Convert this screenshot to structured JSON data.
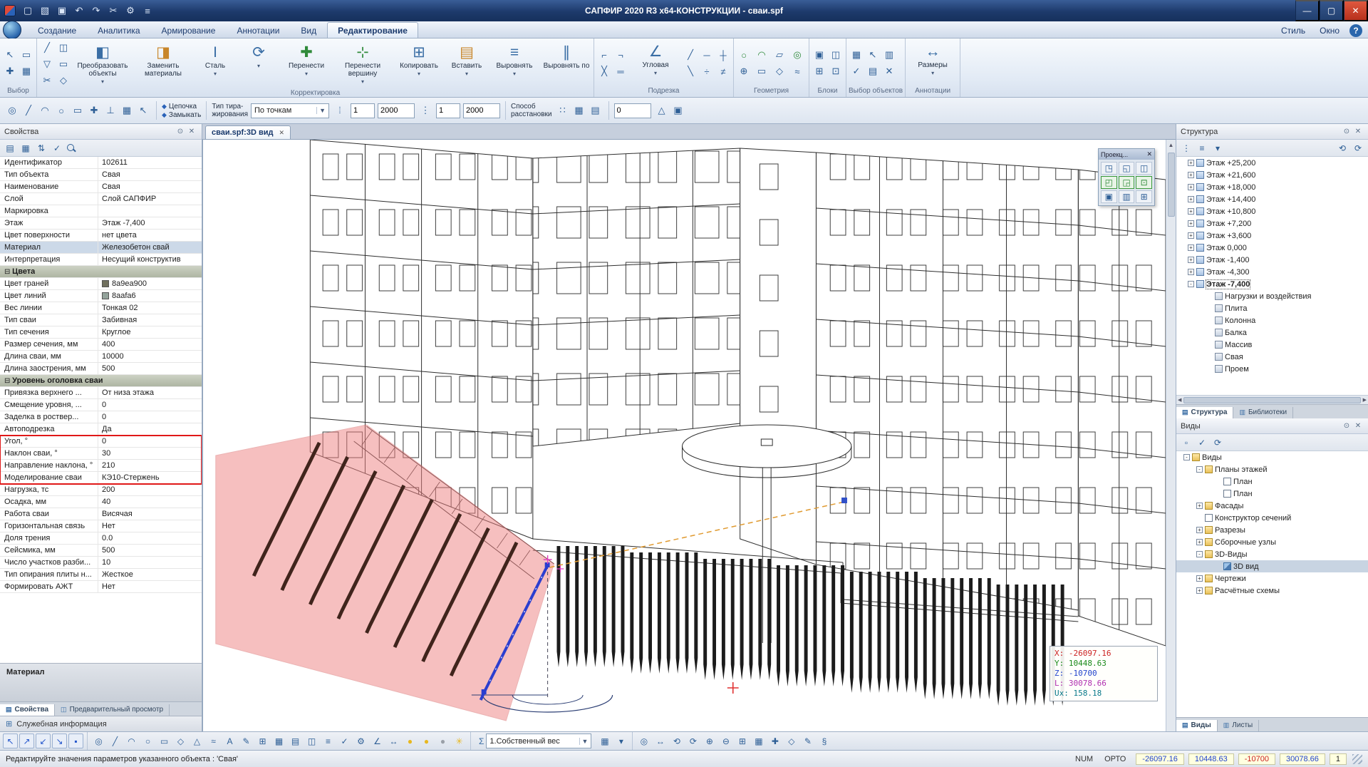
{
  "window": {
    "title": "САПФИР 2020 R3 x64-КОНСТРУКЦИИ - сваи.spf",
    "min": "—",
    "max": "▢",
    "close": "✕"
  },
  "title_icons": [
    {
      "g": "▢",
      "name": "new-file-icon"
    },
    {
      "g": "▧",
      "name": "open-file-icon"
    },
    {
      "g": "▣",
      "name": "save-icon"
    },
    {
      "g": "↶",
      "name": "undo-icon"
    },
    {
      "g": "↷",
      "name": "redo-icon"
    },
    {
      "g": "✂",
      "name": "cut-icon"
    },
    {
      "g": "⚙",
      "name": "settings-icon"
    },
    {
      "g": "≡",
      "name": "app-menu-icon"
    }
  ],
  "menu": {
    "tabs": [
      {
        "label": "Создание",
        "name": "tab-create"
      },
      {
        "label": "Аналитика",
        "name": "tab-analytics"
      },
      {
        "label": "Армирование",
        "name": "tab-reinforcement"
      },
      {
        "label": "Аннотации",
        "name": "tab-annotations"
      },
      {
        "label": "Вид",
        "name": "tab-view"
      },
      {
        "label": "Редактирование",
        "name": "tab-edit",
        "cls": "active"
      }
    ],
    "right": [
      {
        "label": "Стиль",
        "name": "menu-style"
      },
      {
        "label": "Окно",
        "name": "menu-window"
      }
    ],
    "help": "?"
  },
  "ribbon": {
    "group_select": "Выбор",
    "group_correct": "Корректировка",
    "group_trim": "Подрезка",
    "group_geometry": "Геометрия",
    "group_blocks": "Блоки",
    "group_objsel": "Выбор объектов",
    "group_annot": "Аннотации",
    "btn_transform": "Преобразовать объекты",
    "btn_replace": "Заменить материалы",
    "btn_steel": "Сталь",
    "btn_move": "Перенести",
    "btn_move_vertex": "Перенести вершину",
    "btn_copy": "Копировать",
    "btn_paste": "Вставить",
    "btn_align": "Выровнять",
    "btn_align_by": "Выровнять по",
    "btn_corner": "Угловая",
    "btn_dims": "Размеры",
    "select_icons": [
      {
        "g": "↖",
        "name": "select-cursor-icon"
      },
      {
        "g": "▭",
        "name": "select-window-icon"
      },
      {
        "g": "✚",
        "name": "select-add-icon"
      },
      {
        "g": "▦",
        "name": "select-filter-icon"
      }
    ],
    "correct_icons": [
      {
        "g": "╱",
        "name": "edit-line-icon"
      },
      {
        "g": "◫",
        "name": "split-element-icon"
      },
      {
        "g": "▽",
        "name": "mirror-icon"
      },
      {
        "g": "▭",
        "name": "array-icon"
      },
      {
        "g": "✂",
        "name": "trim-element-icon"
      },
      {
        "g": "◇",
        "name": "offset-icon"
      }
    ],
    "trim_icons_a": [
      {
        "g": "⌐",
        "name": "corner-trim-icon"
      },
      {
        "g": "¬",
        "name": "edge-trim-icon"
      },
      {
        "g": "╳",
        "name": "intersect-trim-icon"
      },
      {
        "g": "═",
        "name": "extend-icon"
      }
    ],
    "trim_icons_b": [
      {
        "g": "╱",
        "name": "cut-line-icon"
      },
      {
        "g": "─",
        "name": "cut-edge-icon"
      },
      {
        "g": "┼",
        "name": "cut-cross-icon"
      },
      {
        "g": "╲",
        "name": "cut-back-icon"
      },
      {
        "g": "÷",
        "name": "divide-icon"
      },
      {
        "g": "≠",
        "name": "break-icon"
      }
    ],
    "geometry_icons": [
      {
        "g": "○",
        "name": "circle-tool-icon",
        "cls": "ic-green"
      },
      {
        "g": "◠",
        "name": "arc-tool-icon",
        "cls": "ic-green"
      },
      {
        "g": "▱",
        "name": "parallelogram-tool-icon"
      },
      {
        "g": "◎",
        "name": "ring-tool-icon",
        "cls": "ic-green"
      },
      {
        "g": "⊕",
        "name": "union-tool-icon"
      },
      {
        "g": "▭",
        "name": "rect-tool-icon"
      },
      {
        "g": "◇",
        "name": "rhomb-tool-icon"
      },
      {
        "g": "≈",
        "name": "spline-tool-icon"
      }
    ],
    "blocks_icons": [
      {
        "g": "▣",
        "name": "create-block-icon"
      },
      {
        "g": "◫",
        "name": "edit-block-icon"
      },
      {
        "g": "⊞",
        "name": "insert-block-icon"
      },
      {
        "g": "⊡",
        "name": "explode-block-icon"
      }
    ],
    "objsel_icons": [
      {
        "g": "▦",
        "name": "select-by-type-icon"
      },
      {
        "g": "↖",
        "name": "pick-object-icon"
      },
      {
        "g": "▥",
        "name": "select-layer-icon"
      },
      {
        "g": "✓",
        "name": "confirm-selection-icon"
      },
      {
        "g": "▤",
        "name": "select-story-icon"
      },
      {
        "g": "✕",
        "name": "clear-selection-icon"
      }
    ]
  },
  "toolbar2": {
    "chain": "Цепочка",
    "closing": "Замыкать",
    "type1": "Тип тира-",
    "type2": "жирования",
    "mode": "По точкам",
    "n1": "1",
    "d1": "2000",
    "n2": "1",
    "d2": "2000",
    "place1": "Способ",
    "place2": "расстановки",
    "angle": "0",
    "icons_left": [
      {
        "g": "◎",
        "name": "snap-node-icon"
      },
      {
        "g": "╱",
        "name": "draw-line-icon"
      },
      {
        "g": "◠",
        "name": "draw-arc-icon"
      },
      {
        "g": "○",
        "name": "draw-circle-icon"
      },
      {
        "g": "▭",
        "name": "draw-rect-icon"
      },
      {
        "g": "✚",
        "name": "pick-point-icon"
      },
      {
        "g": "⊥",
        "name": "ortho-mode-icon"
      },
      {
        "g": "▦",
        "name": "grid-mode-icon"
      },
      {
        "g": "↖",
        "name": "cursor-mode-icon"
      }
    ],
    "icons_grid": [
      {
        "g": "∷",
        "name": "by-points-icon"
      },
      {
        "g": "▦",
        "name": "by-grid-icon"
      },
      {
        "g": "▤",
        "name": "by-rows-icon"
      }
    ],
    "icons_right": [
      {
        "g": "△",
        "name": "surface-mode-icon"
      },
      {
        "g": "▣",
        "name": "render-mode-icon"
      }
    ]
  },
  "doc_tab": {
    "label": "сваи.spf:3D вид",
    "close": "✕"
  },
  "props": {
    "title": "Свойства",
    "toolbar_icons": [
      {
        "g": "▤",
        "name": "group-by-icon"
      },
      {
        "g": "▦",
        "name": "grid-view-icon"
      },
      {
        "g": "⇅",
        "name": "sort-icon"
      },
      {
        "g": "✓",
        "name": "apply-icon"
      }
    ],
    "rows_a": [
      {
        "label": "Идентификатор",
        "value": "102611"
      },
      {
        "label": "Тип объекта",
        "value": "Свая"
      },
      {
        "label": "Наименование",
        "value": "Свая"
      },
      {
        "label": "Слой",
        "value": "Слой САПФИР"
      },
      {
        "label": "Маркировка",
        "value": ""
      },
      {
        "label": "Этаж",
        "value": "Этаж -7,400"
      },
      {
        "label": "Цвет поверхности",
        "value": "нет цвета"
      },
      {
        "label": "Материал",
        "value": "Железобетон свай",
        "cls": "sel"
      },
      {
        "label": "Интерпретация",
        "value": "Несущий конструктив"
      },
      {
        "label": "Цвета",
        "cls": "group"
      },
      {
        "label": "Цвет граней",
        "value": "8a9ea900",
        "swatch": "#70705e"
      },
      {
        "label": "Цвет линий",
        "value": "8aafa6",
        "swatch": "#93a39b"
      },
      {
        "label": "Вес линии",
        "value": "Тонкая 02"
      },
      {
        "label": "Тип сваи",
        "value": "Забивная"
      },
      {
        "label": "Тип сечения",
        "value": "Круглое"
      },
      {
        "label": "Размер сечения, мм",
        "value": "400"
      },
      {
        "label": "Длина сваи, мм",
        "value": "10000"
      },
      {
        "label": "Длина заострения, мм",
        "value": "500"
      },
      {
        "label": "Уровень оголовка сваи",
        "cls": "group"
      },
      {
        "label": "Привязка верхнего ...",
        "value": "От низа этажа"
      },
      {
        "label": "Смещение уровня, ...",
        "value": "0"
      },
      {
        "label": "Заделка в роствер...",
        "value": "0"
      },
      {
        "label": "Автоподрезка",
        "value": "Да"
      }
    ],
    "rows_red": [
      {
        "label": "Угол, °",
        "value": "0"
      },
      {
        "label": "Наклон сваи, °",
        "value": "30"
      },
      {
        "label": "Направление наклона, °",
        "value": "210"
      },
      {
        "label": "Моделирование сваи",
        "value": "КЭ10-Стержень"
      }
    ],
    "rows_b": [
      {
        "label": "Нагрузка, тс",
        "value": "200"
      },
      {
        "label": "Осадка, мм",
        "value": "40"
      },
      {
        "label": "Работа сваи",
        "value": "Висячая"
      },
      {
        "label": "Горизонтальная связь",
        "value": "Нет"
      },
      {
        "label": "Доля трения",
        "value": "0.0"
      },
      {
        "label": "Сейсмика, мм",
        "value": "500"
      },
      {
        "label": "Число участков разби...",
        "value": "10"
      },
      {
        "label": "Тип опирания плиты н...",
        "value": "Жесткое"
      },
      {
        "label": "Формировать АЖТ",
        "value": "Нет"
      }
    ],
    "material_header": "Материал",
    "tabs": [
      {
        "label": "Свойства",
        "cls": "active",
        "name": "tab-properties",
        "ti": "▤"
      },
      {
        "label": "Предварительный просмотр",
        "name": "tab-preview",
        "ti": "◫"
      }
    ],
    "service_bar": "Служебная информация"
  },
  "structure": {
    "title": "Структура",
    "toolbar_left": [
      {
        "g": "⋮",
        "name": "filter-icon"
      },
      {
        "g": "≡",
        "name": "list-mode-icon"
      },
      {
        "g": "▾",
        "name": "expand-menu-icon"
      }
    ],
    "toolbar_right": [
      {
        "g": "⟲",
        "name": "refresh-structure-icon"
      },
      {
        "g": "⟳",
        "name": "sync-structure-icon"
      }
    ],
    "items": [
      {
        "exp": "+",
        "icls": "ic-floor",
        "label": "Этаж +25,200",
        "ind": "16px"
      },
      {
        "exp": "+",
        "icls": "ic-floor",
        "label": "Этаж +21,600",
        "ind": "16px"
      },
      {
        "exp": "+",
        "icls": "ic-floor",
        "label": "Этаж +18,000",
        "ind": "16px"
      },
      {
        "exp": "+",
        "icls": "ic-floor",
        "label": "Этаж +14,400",
        "ind": "16px"
      },
      {
        "exp": "+",
        "icls": "ic-floor",
        "label": "Этаж +10,800",
        "ind": "16px"
      },
      {
        "exp": "+",
        "icls": "ic-floor",
        "label": "Этаж +7,200",
        "ind": "16px"
      },
      {
        "exp": "+",
        "icls": "ic-floor",
        "label": "Этаж +3,600",
        "ind": "16px"
      },
      {
        "exp": "+",
        "icls": "ic-floor",
        "label": "Этаж 0,000",
        "ind": "16px"
      },
      {
        "exp": "+",
        "icls": "ic-floor",
        "label": "Этаж -1,400",
        "ind": "16px"
      },
      {
        "exp": "+",
        "icls": "ic-floor",
        "label": "Этаж -4,300",
        "ind": "16px"
      },
      {
        "exp": "-",
        "icls": "ic-floor",
        "label": "Этаж -7,400",
        "ind": "16px",
        "cls": "focus"
      },
      {
        "icls": "ic-elem",
        "label": "Нагрузки и воздействия",
        "ind": "42px"
      },
      {
        "icls": "ic-elem",
        "label": "Плита",
        "ind": "42px"
      },
      {
        "icls": "ic-elem",
        "label": "Колонна",
        "ind": "42px"
      },
      {
        "icls": "ic-elem",
        "label": "Балка",
        "ind": "42px"
      },
      {
        "icls": "ic-elem",
        "label": "Массив",
        "ind": "42px"
      },
      {
        "icls": "ic-elem",
        "label": "Свая",
        "ind": "42px"
      },
      {
        "icls": "ic-elem",
        "label": "Проем",
        "ind": "42px"
      }
    ],
    "tabs": [
      {
        "label": "Структура",
        "cls": "active",
        "name": "tab-structure",
        "ti": "▤"
      },
      {
        "label": "Библиотеки",
        "name": "tab-libraries",
        "ti": "▥"
      }
    ]
  },
  "views": {
    "title": "Виды",
    "toolbar_icons": [
      {
        "g": "▫",
        "name": "new-view-icon"
      },
      {
        "g": "✓",
        "name": "apply-view-icon"
      },
      {
        "g": "⟳",
        "name": "refresh-views-icon"
      }
    ],
    "items": [
      {
        "exp": "-",
        "icls": "ic-folder",
        "label": "Виды",
        "ind": "10px"
      },
      {
        "exp": "-",
        "icls": "ic-folder",
        "label": "Планы этажей",
        "ind": "28px"
      },
      {
        "icls": "ic-plan",
        "label": "План",
        "ind": "54px"
      },
      {
        "icls": "ic-plan",
        "label": "План",
        "ind": "54px"
      },
      {
        "exp": "+",
        "icls": "ic-folder",
        "label": "Фасады",
        "ind": "28px"
      },
      {
        "icls": "ic-plan",
        "label": "Конструктор сечений",
        "ind": "28px"
      },
      {
        "exp": "+",
        "icls": "ic-folder",
        "label": "Разрезы",
        "ind": "28px"
      },
      {
        "exp": "+",
        "icls": "ic-folder",
        "label": "Сборочные узлы",
        "ind": "28px"
      },
      {
        "exp": "-",
        "icls": "ic-folder",
        "label": "3D-Виды",
        "ind": "28px"
      },
      {
        "icls": "ic-3d",
        "label": "3D вид",
        "ind": "54px",
        "cls": "sel"
      },
      {
        "exp": "+",
        "icls": "ic-folder",
        "label": "Чертежи",
        "ind": "28px"
      },
      {
        "exp": "+",
        "icls": "ic-folder",
        "label": "Расчётные схемы",
        "ind": "28px"
      }
    ],
    "tabs": [
      {
        "label": "Виды",
        "cls": "active",
        "name": "tab-views",
        "ti": "▤"
      },
      {
        "label": "Листы",
        "name": "tab-sheets",
        "ti": "▥"
      }
    ]
  },
  "proj": {
    "title": "Проекц...",
    "close": "✕",
    "icons": [
      {
        "g": "◳",
        "name": "projection-top-icon"
      },
      {
        "g": "◱",
        "name": "projection-front-icon"
      },
      {
        "g": "◫",
        "name": "projection-side-icon"
      },
      {
        "g": "◰",
        "name": "projection-back-icon",
        "cls": "on"
      },
      {
        "g": "◲",
        "name": "projection-left-icon",
        "cls": "on"
      },
      {
        "g": "⊡",
        "name": "projection-iso-icon",
        "cls": "on"
      },
      {
        "g": "▣",
        "name": "projection-3d-icon"
      },
      {
        "g": "▥",
        "name": "projection-section-icon"
      },
      {
        "g": "⊞",
        "name": "projection-grid-icon"
      }
    ]
  },
  "coord": {
    "lines": [
      {
        "k": "X:",
        "v": "-26097.16",
        "cls": "c-red"
      },
      {
        "k": "Y:",
        "v": "10448.63",
        "cls": "c-green"
      },
      {
        "k": "Z:",
        "v": "-10700",
        "cls": "c-blue"
      },
      {
        "k": "L:",
        "v": "30078.66",
        "cls": "c-mag"
      },
      {
        "k": "Ux:",
        "v": "158.18",
        "cls": "c-teal"
      }
    ]
  },
  "bottom": {
    "left_icons": [
      {
        "g": "↖",
        "name": "snap-corner-icon"
      },
      {
        "g": "↗",
        "name": "snap-edge-icon"
      },
      {
        "g": "↙",
        "name": "snap-mid-icon"
      },
      {
        "g": "↘",
        "name": "snap-center-icon"
      },
      {
        "g": "▪",
        "name": "snap-point-icon"
      }
    ],
    "main_icons": [
      {
        "g": "◎",
        "name": "aim-icon"
      },
      {
        "g": "╱",
        "name": "line-icon"
      },
      {
        "g": "◠",
        "name": "arc-icon"
      },
      {
        "g": "○",
        "name": "circle-icon"
      },
      {
        "g": "▭",
        "name": "rect-icon"
      },
      {
        "g": "◇",
        "name": "polygon-icon"
      },
      {
        "g": "△",
        "name": "triangle-icon"
      },
      {
        "g": "≈",
        "name": "spline-icon"
      },
      {
        "g": "A",
        "name": "text-icon"
      },
      {
        "g": "✎",
        "name": "sketch-icon"
      },
      {
        "g": "⊞",
        "name": "add-node-icon"
      },
      {
        "g": "▦",
        "name": "mesh-icon"
      },
      {
        "g": "▤",
        "name": "layers-icon"
      },
      {
        "g": "◫",
        "name": "section-icon"
      },
      {
        "g": "≡",
        "name": "list-icon"
      },
      {
        "g": "✓",
        "name": "check-icon"
      },
      {
        "g": "⚙",
        "name": "gear-icon"
      },
      {
        "g": "∠",
        "name": "angle-icon"
      },
      {
        "g": "↔",
        "name": "dimension-icon"
      },
      {
        "g": "●",
        "name": "bulb-on-icon",
        "cls": "bulb"
      },
      {
        "g": "●",
        "name": "bulb-on-icon-2",
        "cls": "bulb"
      },
      {
        "g": "●",
        "name": "bulb-off-icon",
        "cls": "bulb-off"
      },
      {
        "g": "✳",
        "name": "light-icon",
        "cls": "bulb"
      }
    ],
    "load_case": "1.Собственный вес",
    "after_load_icons": [
      {
        "g": "▦",
        "name": "load-table-icon"
      },
      {
        "g": "▾",
        "name": "load-options-icon"
      }
    ],
    "right_icons": [
      {
        "g": "◎",
        "name": "center-view-icon"
      },
      {
        "g": "↔",
        "name": "pan-icon"
      },
      {
        "g": "⟲",
        "name": "rotate-left-icon"
      },
      {
        "g": "⟳",
        "name": "rotate-right-icon"
      },
      {
        "g": "⊕",
        "name": "zoom-in-icon"
      },
      {
        "g": "⊖",
        "name": "zoom-out-icon"
      },
      {
        "g": "⊞",
        "name": "fit-view-icon"
      },
      {
        "g": "▦",
        "name": "grid-toggle-icon"
      },
      {
        "g": "✚",
        "name": "move-view-icon"
      },
      {
        "g": "◇",
        "name": "iso-view-icon"
      },
      {
        "g": "✎",
        "name": "edit-mode-icon"
      },
      {
        "g": "§",
        "name": "object-props-icon"
      }
    ]
  },
  "status": {
    "message": "Редактируйте значения параметров указанного объекта : 'Свая'",
    "num": "NUM",
    "orto": "ОРТО",
    "vals": [
      {
        "v": "-26097.16",
        "cls": "c-blue"
      },
      {
        "v": "10448.63",
        "cls": "c-blue"
      },
      {
        "v": "-10700",
        "cls": "c-red"
      },
      {
        "v": "30078.66",
        "cls": "c-blue"
      },
      {
        "v": "1",
        "cls": "c-dark"
      }
    ]
  }
}
